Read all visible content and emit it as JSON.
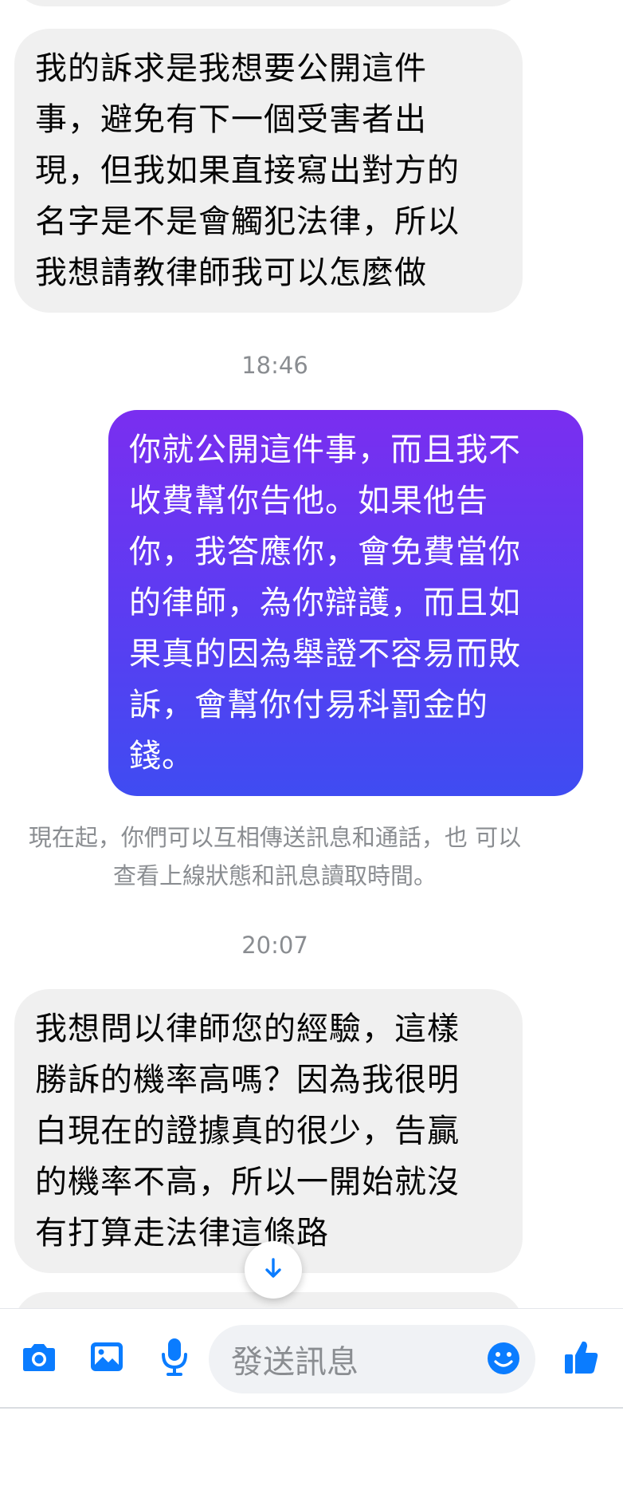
{
  "messages": {
    "m1": "我的訴求是我想要公開這件\n事，避免有下一個受害者出\n現，但我如果直接寫出對方的\n名字是不是會觸犯法律，所以\n我想請教律師我可以怎麼做",
    "ts1": "18:46",
    "m2": "你就公開這件事，而且我不\n收費幫你告他。如果他告\n你，我答應你，會免費當你\n的律師，為你辯護，而且如\n果真的因為舉證不容易而敗\n訴，會幫你付易科罰金的\n錢。",
    "system": "現在起，你們可以互相傳送訊息和通話，也\n可以查看上線狀態和訊息讀取時間。",
    "ts2": "20:07",
    "m3": "我想問以律師您的經驗，這樣\n勝訴的機率高嗎？因為我很明\n白現在的證據真的很少，告贏\n的機率不高，所以一開始就沒\n有打算走法律這條路"
  },
  "composer": {
    "placeholder": "發送訊息"
  },
  "icons": {
    "camera": "camera-icon",
    "gallery": "image-icon",
    "mic": "microphone-icon",
    "emoji": "emoji-icon",
    "like": "thumbs-up-icon",
    "scroll": "arrow-down-icon"
  },
  "colors": {
    "accent": "#0a7cff",
    "incoming_bubble": "#f0f0f0",
    "outgoing_top": "#7a2ef0",
    "outgoing_bottom": "#3f4cf2",
    "meta_text": "#8a8d91"
  }
}
